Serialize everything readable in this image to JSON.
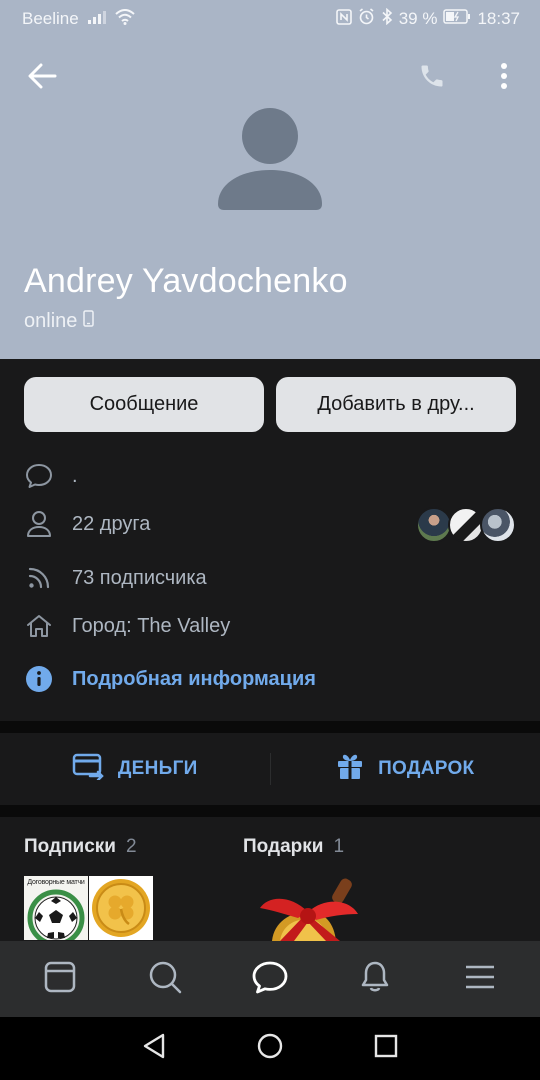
{
  "statusbar": {
    "carrier": "Beeline",
    "battery": "39 %",
    "time": "18:37"
  },
  "profile": {
    "name": "Andrey Yavdochenko",
    "status": "online"
  },
  "buttons": {
    "message": "Сообщение",
    "add_friend": "Добавить в дру..."
  },
  "info": {
    "status_text": ".",
    "friends": "22 друга",
    "followers": "73 подписчика",
    "city": "Город: The Valley",
    "details_link": "Подробная информация"
  },
  "actions": {
    "money": "ДЕНЬГИ",
    "gift": "ПОДАРОК"
  },
  "sections": {
    "subscriptions": {
      "label": "Подписки",
      "count": "2"
    },
    "gifts": {
      "label": "Подарки",
      "count": "1"
    }
  },
  "subscription_thumbs": [
    {
      "caption": "Договорные матчи"
    }
  ],
  "colors": {
    "header_bg": "#aab5c6",
    "page_bg": "#19191a",
    "accent": "#71aaeb",
    "button_bg": "#e1e3e6",
    "tabbar_bg": "#2c2d2e"
  },
  "icons": [
    "back-icon",
    "phone-icon",
    "more-icon",
    "avatar-placeholder-icon",
    "mobile-icon",
    "comment-icon",
    "user-icon",
    "rss-icon",
    "home-icon",
    "info-icon",
    "money-card-icon",
    "gift-icon",
    "feed-icon",
    "search-icon",
    "messages-icon",
    "bell-icon",
    "menu-icon"
  ]
}
